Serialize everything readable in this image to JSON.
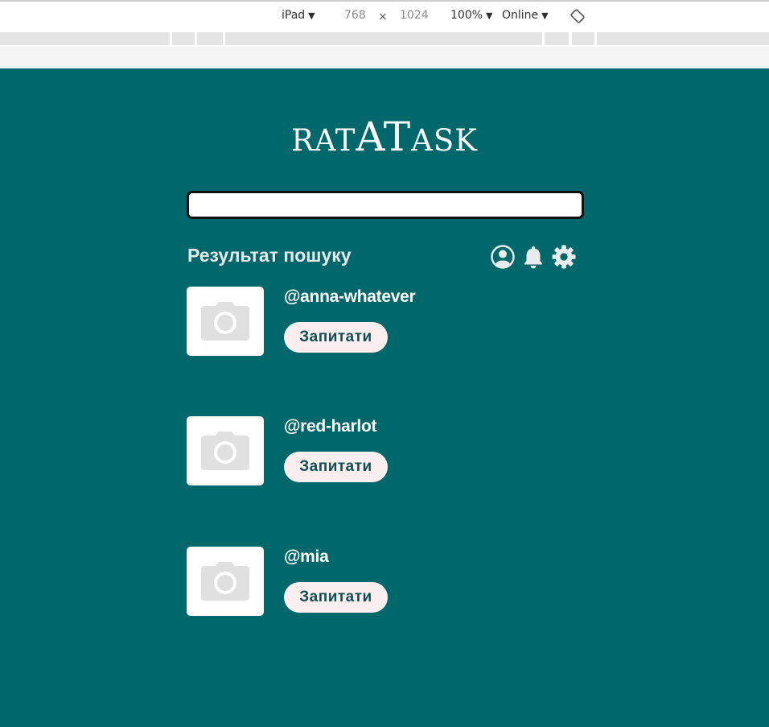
{
  "devtools": {
    "device": "iPad",
    "width": "768",
    "times": "×",
    "height": "1024",
    "zoom": "100%",
    "network": "Online",
    "caret": "▼",
    "rotate_icon": "rotate-icon"
  },
  "app": {
    "logo": {
      "part1": "RAT",
      "part2": "AT",
      "part3": "ASK"
    },
    "search": {
      "value": "",
      "placeholder": ""
    },
    "results_title": "Результат пошуку",
    "icons": [
      "account-icon",
      "bell-icon",
      "gear-icon"
    ],
    "users": [
      {
        "username": "@anna-whatever",
        "button_label": "Запитати"
      },
      {
        "username": "@red-harlot",
        "button_label": "Запитати"
      },
      {
        "username": "@mia",
        "button_label": "Запитати"
      }
    ]
  },
  "colors": {
    "background": "#00686b",
    "button_bg": "#fbeeee",
    "button_text": "#0f4e52",
    "avatar_bg": "#ffffff",
    "camera_placeholder": "#e0e0e0"
  }
}
